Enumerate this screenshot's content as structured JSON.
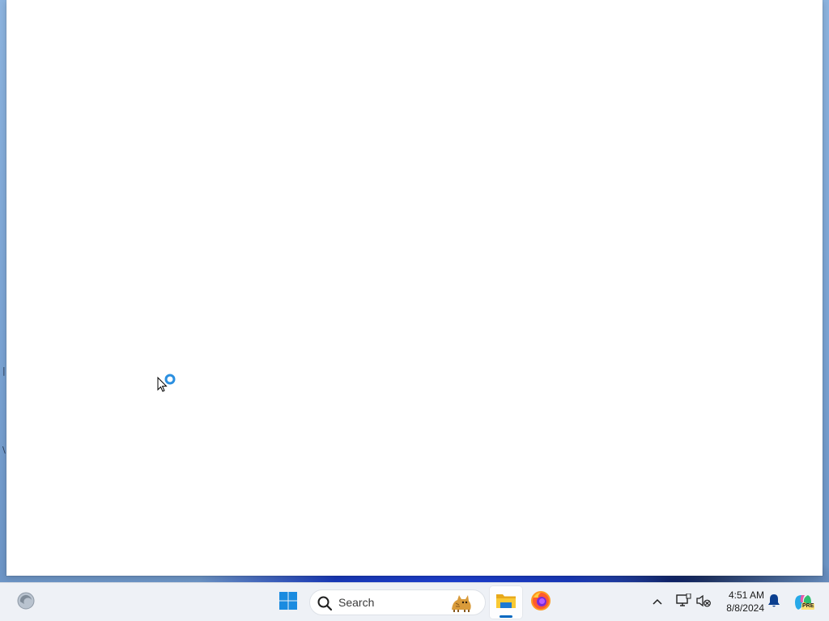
{
  "taskbar": {
    "search_placeholder": "Search",
    "apps": [
      {
        "name": "file-explorer",
        "active": true
      },
      {
        "name": "firefox",
        "active": false
      }
    ],
    "clock": {
      "time": "4:51 AM",
      "date": "8/8/2024"
    },
    "copilot_badge": "PRE"
  },
  "colors": {
    "taskbar_bg": "#eef1f6",
    "accent": "#0067c0",
    "window_bg": "#ffffff"
  }
}
